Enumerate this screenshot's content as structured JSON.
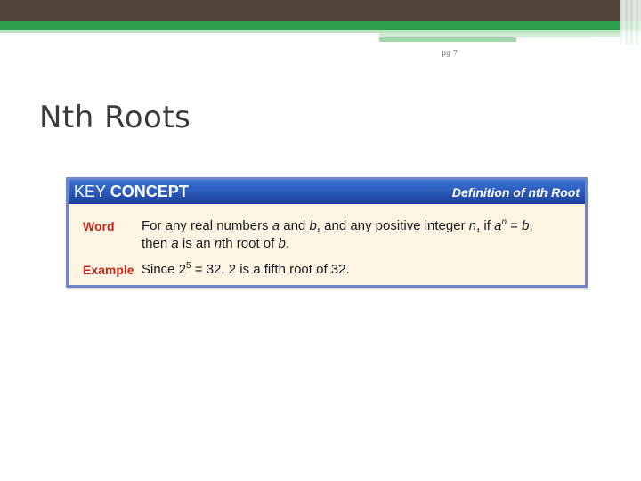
{
  "header": {
    "page_number": "pg 7"
  },
  "slide": {
    "title": "Nth Roots"
  },
  "concept": {
    "label_key": "KEY",
    "label_concept": "CONCEPT",
    "title": "Definition of nth Root",
    "word": {
      "label": "Word",
      "line1_pre": "For any real numbers ",
      "var_a": "a",
      "line1_and": " and ",
      "var_b": "b",
      "line1_mid": ", and any positive integer ",
      "var_n": "n",
      "line1_if": ", if ",
      "sup_n": "n",
      "line1_eq": " = ",
      "line1_end": ",",
      "line2_then": "then ",
      "line2_isan": " is an ",
      "line2_nth": "th root of ",
      "line2_end": "."
    },
    "example": {
      "label": "Example",
      "pre": "Since 2",
      "sup": "5",
      "post": " = 32, 2 is a fifth root of 32."
    }
  }
}
